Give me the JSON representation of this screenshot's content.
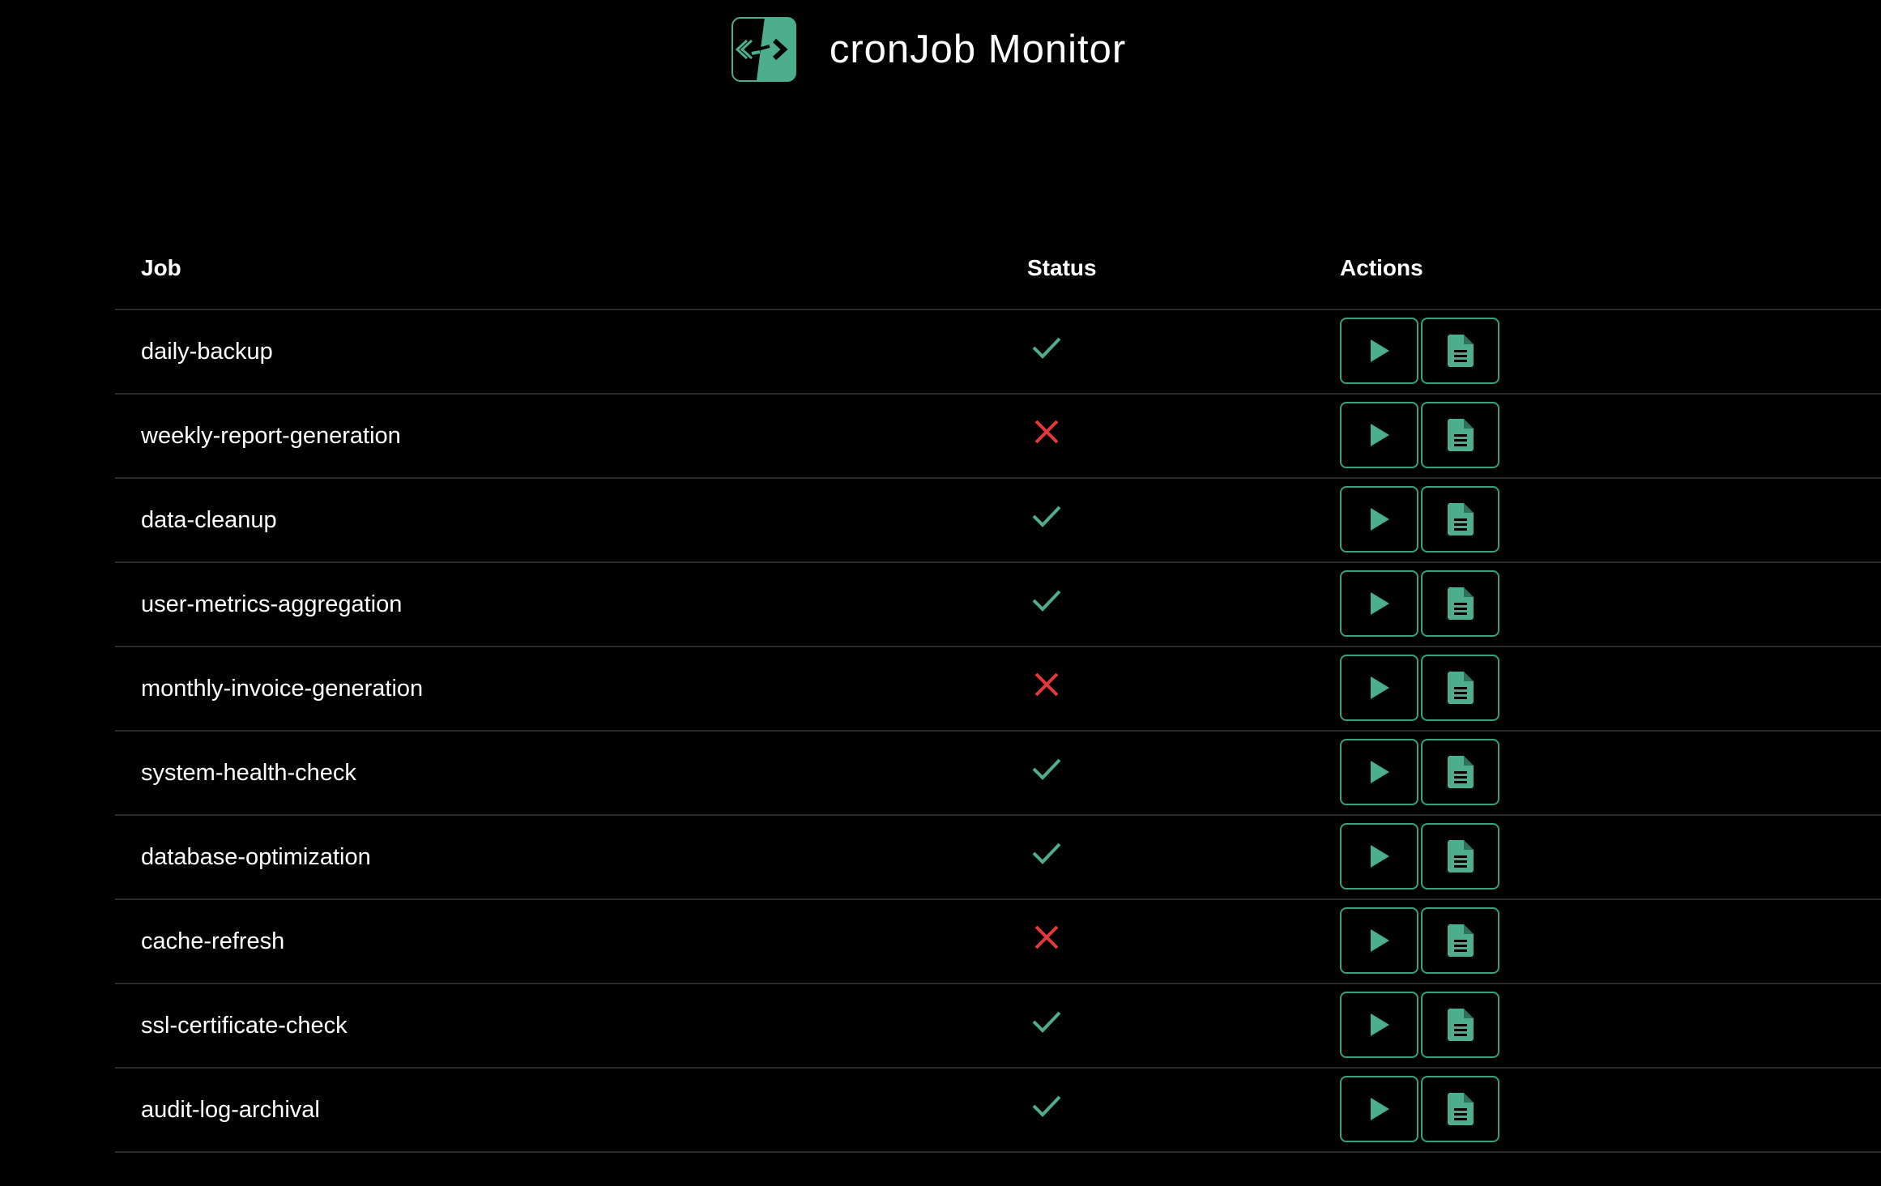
{
  "app": {
    "title": "cronJob Monitor",
    "logo_icon": "code-split-logo-icon"
  },
  "colors": {
    "background": "#000000",
    "accent": "#4cae8c",
    "success": "#4cae8c",
    "failure": "#e53935",
    "divider": "#2a2a2a"
  },
  "table": {
    "headers": {
      "job": "Job",
      "status": "Status",
      "actions": "Actions"
    },
    "rows": [
      {
        "job": "daily-backup",
        "status": "success"
      },
      {
        "job": "weekly-report-generation",
        "status": "failed"
      },
      {
        "job": "data-cleanup",
        "status": "success"
      },
      {
        "job": "user-metrics-aggregation",
        "status": "success"
      },
      {
        "job": "monthly-invoice-generation",
        "status": "failed"
      },
      {
        "job": "system-health-check",
        "status": "success"
      },
      {
        "job": "database-optimization",
        "status": "success"
      },
      {
        "job": "cache-refresh",
        "status": "failed"
      },
      {
        "job": "ssl-certificate-check",
        "status": "success"
      },
      {
        "job": "audit-log-archival",
        "status": "success"
      }
    ],
    "action_icons": {
      "run": "play-icon",
      "logs": "document-icon"
    }
  }
}
